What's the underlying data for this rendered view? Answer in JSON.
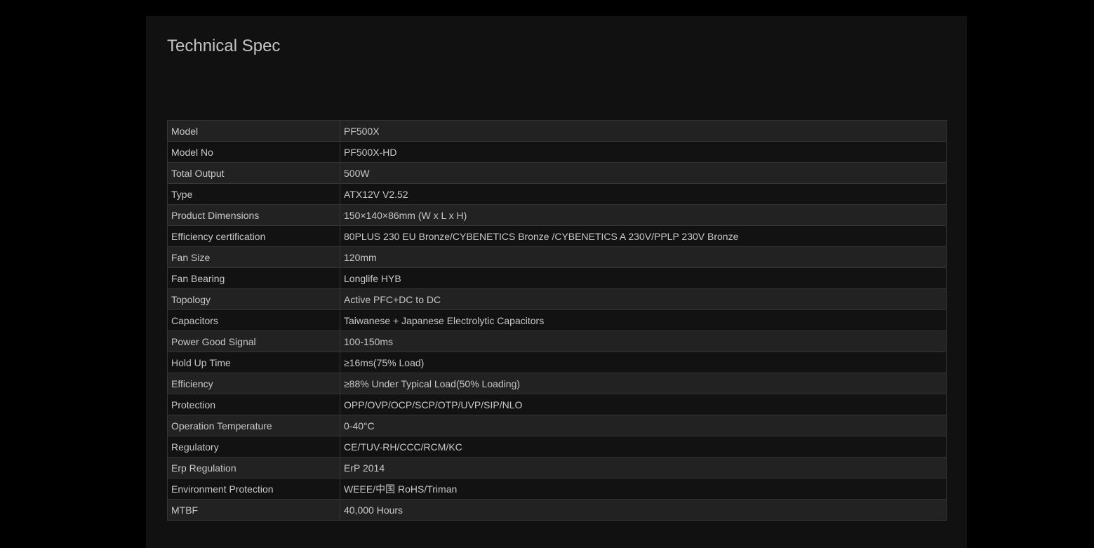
{
  "page": {
    "title": "Technical Spec"
  },
  "colors": {
    "page_background": "#000000",
    "panel_background": "#111111",
    "row_odd": "#222222",
    "row_even": "#121212",
    "border": "#343434",
    "text": "#c8c8c8"
  },
  "spec_table": {
    "rows": [
      {
        "label": "Model",
        "value": "PF500X"
      },
      {
        "label": "Model No",
        "value": "PF500X-HD"
      },
      {
        "label": "Total Output",
        "value": "500W"
      },
      {
        "label": "Type",
        "value": "ATX12V V2.52"
      },
      {
        "label": "Product Dimensions",
        "value": "150×140×86mm (W x L x H)"
      },
      {
        "label": "Efficiency certification",
        "value": "80PLUS 230 EU Bronze/CYBENETICS Bronze /CYBENETICS A 230V/PPLP 230V Bronze"
      },
      {
        "label": "Fan Size",
        "value": "120mm"
      },
      {
        "label": "Fan Bearing",
        "value": "Longlife HYB"
      },
      {
        "label": "Topology",
        "value": "Active PFC+DC to DC"
      },
      {
        "label": "Capacitors",
        "value": "Taiwanese + Japanese Electrolytic Capacitors"
      },
      {
        "label": "Power Good Signal",
        "value": "100-150ms"
      },
      {
        "label": "Hold Up Time",
        "value": "≥16ms(75% Load)"
      },
      {
        "label": "Efficiency",
        "value": "≥88% Under Typical Load(50% Loading)"
      },
      {
        "label": "Protection",
        "value": "OPP/OVP/OCP/SCP/OTP/UVP/SIP/NLO"
      },
      {
        "label": "Operation Temperature",
        "value": "0-40°C"
      },
      {
        "label": "Regulatory",
        "value": "CE/TUV-RH/CCC/RCM/KC"
      },
      {
        "label": "Erp Regulation",
        "value": "ErP 2014"
      },
      {
        "label": "Environment Protection",
        "value": "WEEE/中国 RoHS/Triman"
      },
      {
        "label": "MTBF",
        "value": "40,000 Hours"
      }
    ]
  }
}
